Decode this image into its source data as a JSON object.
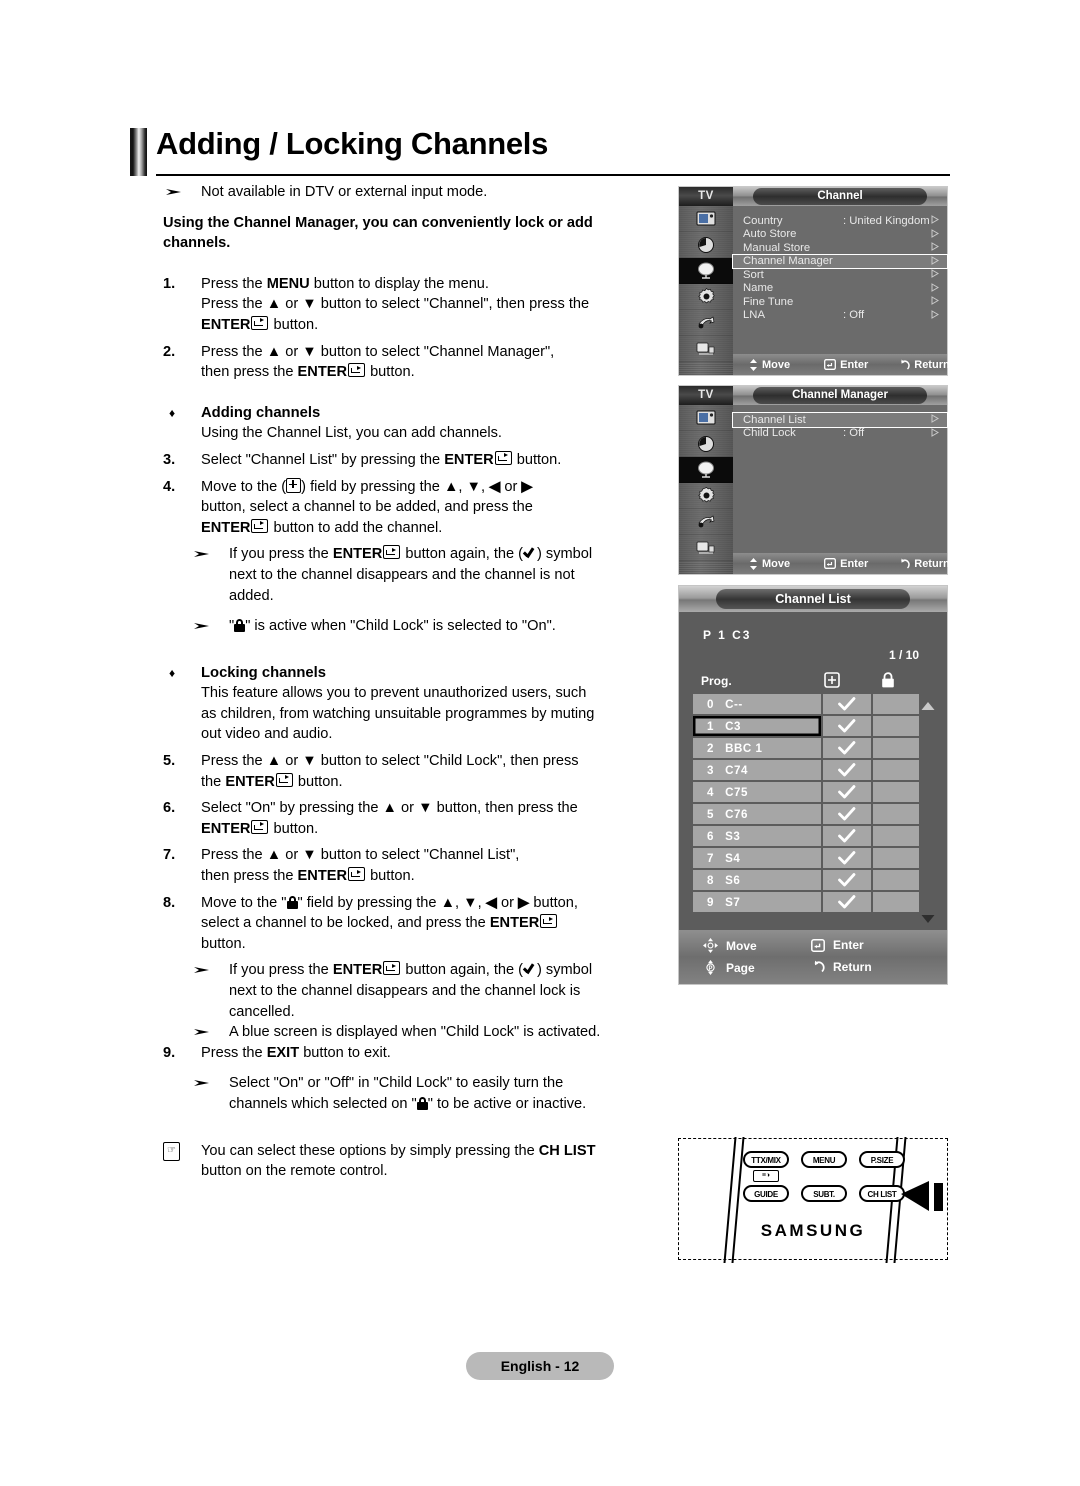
{
  "page": {
    "title": "Adding / Locking Channels",
    "footer_badge": "English - 12"
  },
  "intro": {
    "note": "Not available in DTV or external input mode.",
    "lead_line1": "Using the Channel Manager, you can conveniently lock or add",
    "lead_line2": "channels."
  },
  "steps": {
    "s1_num": "1.",
    "s1_l1_a": "Press the ",
    "s1_l1_b": "MENU",
    "s1_l1_c": " button to display the menu.",
    "s1_l2_a": "Press the ",
    "s1_l2_b": "▲",
    "s1_l2_c": " or ",
    "s1_l2_d": "▼",
    "s1_l2_e": " button to select \"Channel\", then press the",
    "s1_l3_a": "ENTER",
    "s1_l3_b": " button.",
    "s2_num": "2.",
    "s2_l1_a": "Press the ",
    "s2_l1_b": "▲",
    "s2_l1_c": " or ",
    "s2_l1_d": "▼",
    "s2_l1_e": " button to select \"Channel Manager\",",
    "s2_l2_a": "then press the ",
    "s2_l2_b": "ENTER",
    "s2_l2_c": " button.",
    "adding_title": "Adding channels",
    "adding_sub": "Using the Channel List, you can add channels.",
    "s3_num": "3.",
    "s3_a": "Select \"Channel List\" by pressing the ",
    "s3_b": "ENTER",
    "s3_c": " button.",
    "s4_num": "4.",
    "s4_l1_a": "Move to the (",
    "s4_l1_b": ") field by pressing the ",
    "s4_l1_c": "▲",
    "s4_l1_d": ", ",
    "s4_l1_e": "▼",
    "s4_l1_f": ", ",
    "s4_l1_g": "◀",
    "s4_l1_h": " or ",
    "s4_l1_i": "▶",
    "s4_l2": "button, select a channel to be added, and press the",
    "s4_l3_a": "ENTER",
    "s4_l3_b": " button to add the channel.",
    "n1_l1_a": "If you press the ",
    "n1_l1_b": "ENTER",
    "n1_l1_c": " button again, the (",
    "n1_l1_d": ") symbol",
    "n1_l2": "next to the channel disappears and the channel is not",
    "n1_l3": "added.",
    "n2_a": "\"",
    "n2_b": "\" is active when \"Child Lock\" is selected to \"On\".",
    "locking_title": "Locking channels",
    "locking_l1": "This feature allows you to prevent unauthorized users, such",
    "locking_l2": "as children, from watching unsuitable programmes by muting",
    "locking_l3": "out video and audio.",
    "s5_num": "5.",
    "s5_l1_a": "Press the ",
    "s5_l1_b": "▲",
    "s5_l1_c": " or ",
    "s5_l1_d": "▼",
    "s5_l1_e": " button to select \"Child Lock\", then press",
    "s5_l2_a": "the ",
    "s5_l2_b": "ENTER",
    "s5_l2_c": " button.",
    "s6_num": "6.",
    "s6_l1_a": "Select \"On\" by pressing the ",
    "s6_l1_b": "▲",
    "s6_l1_c": " or ",
    "s6_l1_d": "▼",
    "s6_l1_e": " button, then press the",
    "s6_l2_a": "ENTER",
    "s6_l2_b": " button.",
    "s7_num": "7.",
    "s7_l1_a": "Press the ",
    "s7_l1_b": "▲",
    "s7_l1_c": " or ",
    "s7_l1_d": "▼",
    "s7_l1_e": " button to select \"Channel List\",",
    "s7_l2_a": "then press the ",
    "s7_l2_b": "ENTER",
    "s7_l2_c": " button.",
    "s8_num": "8.",
    "s8_l1_a": "Move to the \"",
    "s8_l1_b": "\" field by pressing the ",
    "s8_l1_c": "▲",
    "s8_l1_d": ", ",
    "s8_l1_e": "▼",
    "s8_l1_f": ", ",
    "s8_l1_g": "◀",
    "s8_l1_h": " or ",
    "s8_l1_i": "▶",
    "s8_l1_j": " button,",
    "s8_l2_a": "select a channel to be locked, and press the ",
    "s8_l2_b": "ENTER",
    "s8_l3": "button.",
    "n3_l1_a": "If you press the ",
    "n3_l1_b": "ENTER",
    "n3_l1_c": " button again, the (",
    "n3_l1_d": ") symbol",
    "n3_l2": "next to the channel disappears and the channel lock is",
    "n3_l3": "cancelled.",
    "n4": "A blue screen is displayed when \"Child Lock\" is activated.",
    "s9_num": "9.",
    "s9_a": "Press the ",
    "s9_b": "EXIT",
    "s9_c": " button to exit.",
    "n5_l1": "Select \"On\" or \"Off\" in \"Child Lock\" to easily turn the",
    "n5_l2_a": "channels which selected on \"",
    "n5_l2_b": "\" to be active or inactive.",
    "tip_l1_a": "You can select these options by simply pressing the ",
    "tip_l1_b": "CH LIST",
    "tip_l2": "button on the remote control."
  },
  "osd_channel": {
    "device_label": "TV",
    "title": "Channel",
    "items": [
      {
        "name": "Country",
        "value": ": United Kingdom",
        "selected": false
      },
      {
        "name": "Auto Store",
        "value": "",
        "selected": false
      },
      {
        "name": "Manual Store",
        "value": "",
        "selected": false
      },
      {
        "name": "Channel Manager",
        "value": "",
        "selected": true
      },
      {
        "name": "Sort",
        "value": "",
        "selected": false
      },
      {
        "name": "Name",
        "value": "",
        "selected": false
      },
      {
        "name": "Fine Tune",
        "value": "",
        "selected": false
      },
      {
        "name": "LNA",
        "value": ": Off",
        "selected": false
      }
    ],
    "footer": {
      "move": "Move",
      "enter": "Enter",
      "return": "Return"
    }
  },
  "osd_manager": {
    "device_label": "TV",
    "title": "Channel Manager",
    "items": [
      {
        "name": "Channel List",
        "value": "",
        "selected": true
      },
      {
        "name": "Child Lock",
        "value": ": Off",
        "selected": false
      }
    ],
    "footer": {
      "move": "Move",
      "enter": "Enter",
      "return": "Return"
    }
  },
  "channel_list": {
    "title": "Channel List",
    "current": "P  1  C3",
    "page_indicator": "1 / 10",
    "col_prog": "Prog.",
    "rows": [
      {
        "num": "0",
        "name": "C--",
        "added": true,
        "locked": false,
        "selected": false
      },
      {
        "num": "1",
        "name": "C3",
        "added": true,
        "locked": false,
        "selected": true
      },
      {
        "num": "2",
        "name": "BBC 1",
        "added": true,
        "locked": false,
        "selected": false
      },
      {
        "num": "3",
        "name": "C74",
        "added": true,
        "locked": false,
        "selected": false
      },
      {
        "num": "4",
        "name": "C75",
        "added": true,
        "locked": false,
        "selected": false
      },
      {
        "num": "5",
        "name": "C76",
        "added": true,
        "locked": false,
        "selected": false
      },
      {
        "num": "6",
        "name": "S3",
        "added": true,
        "locked": false,
        "selected": false
      },
      {
        "num": "7",
        "name": "S4",
        "added": true,
        "locked": false,
        "selected": false
      },
      {
        "num": "8",
        "name": "S6",
        "added": true,
        "locked": false,
        "selected": false
      },
      {
        "num": "9",
        "name": "S7",
        "added": true,
        "locked": false,
        "selected": false
      }
    ],
    "legend_add": "Add",
    "legend_lock": "Lock",
    "nav": {
      "move": "Move",
      "enter": "Enter",
      "page": "Page",
      "return": "Return"
    }
  },
  "remote": {
    "buttons": [
      "TTX/MIX",
      "MENU",
      "P.SIZE",
      "GUIDE",
      "SUBT.",
      "CH LIST"
    ],
    "sub_button": "≡◑",
    "brand": "SAMSUNG"
  }
}
